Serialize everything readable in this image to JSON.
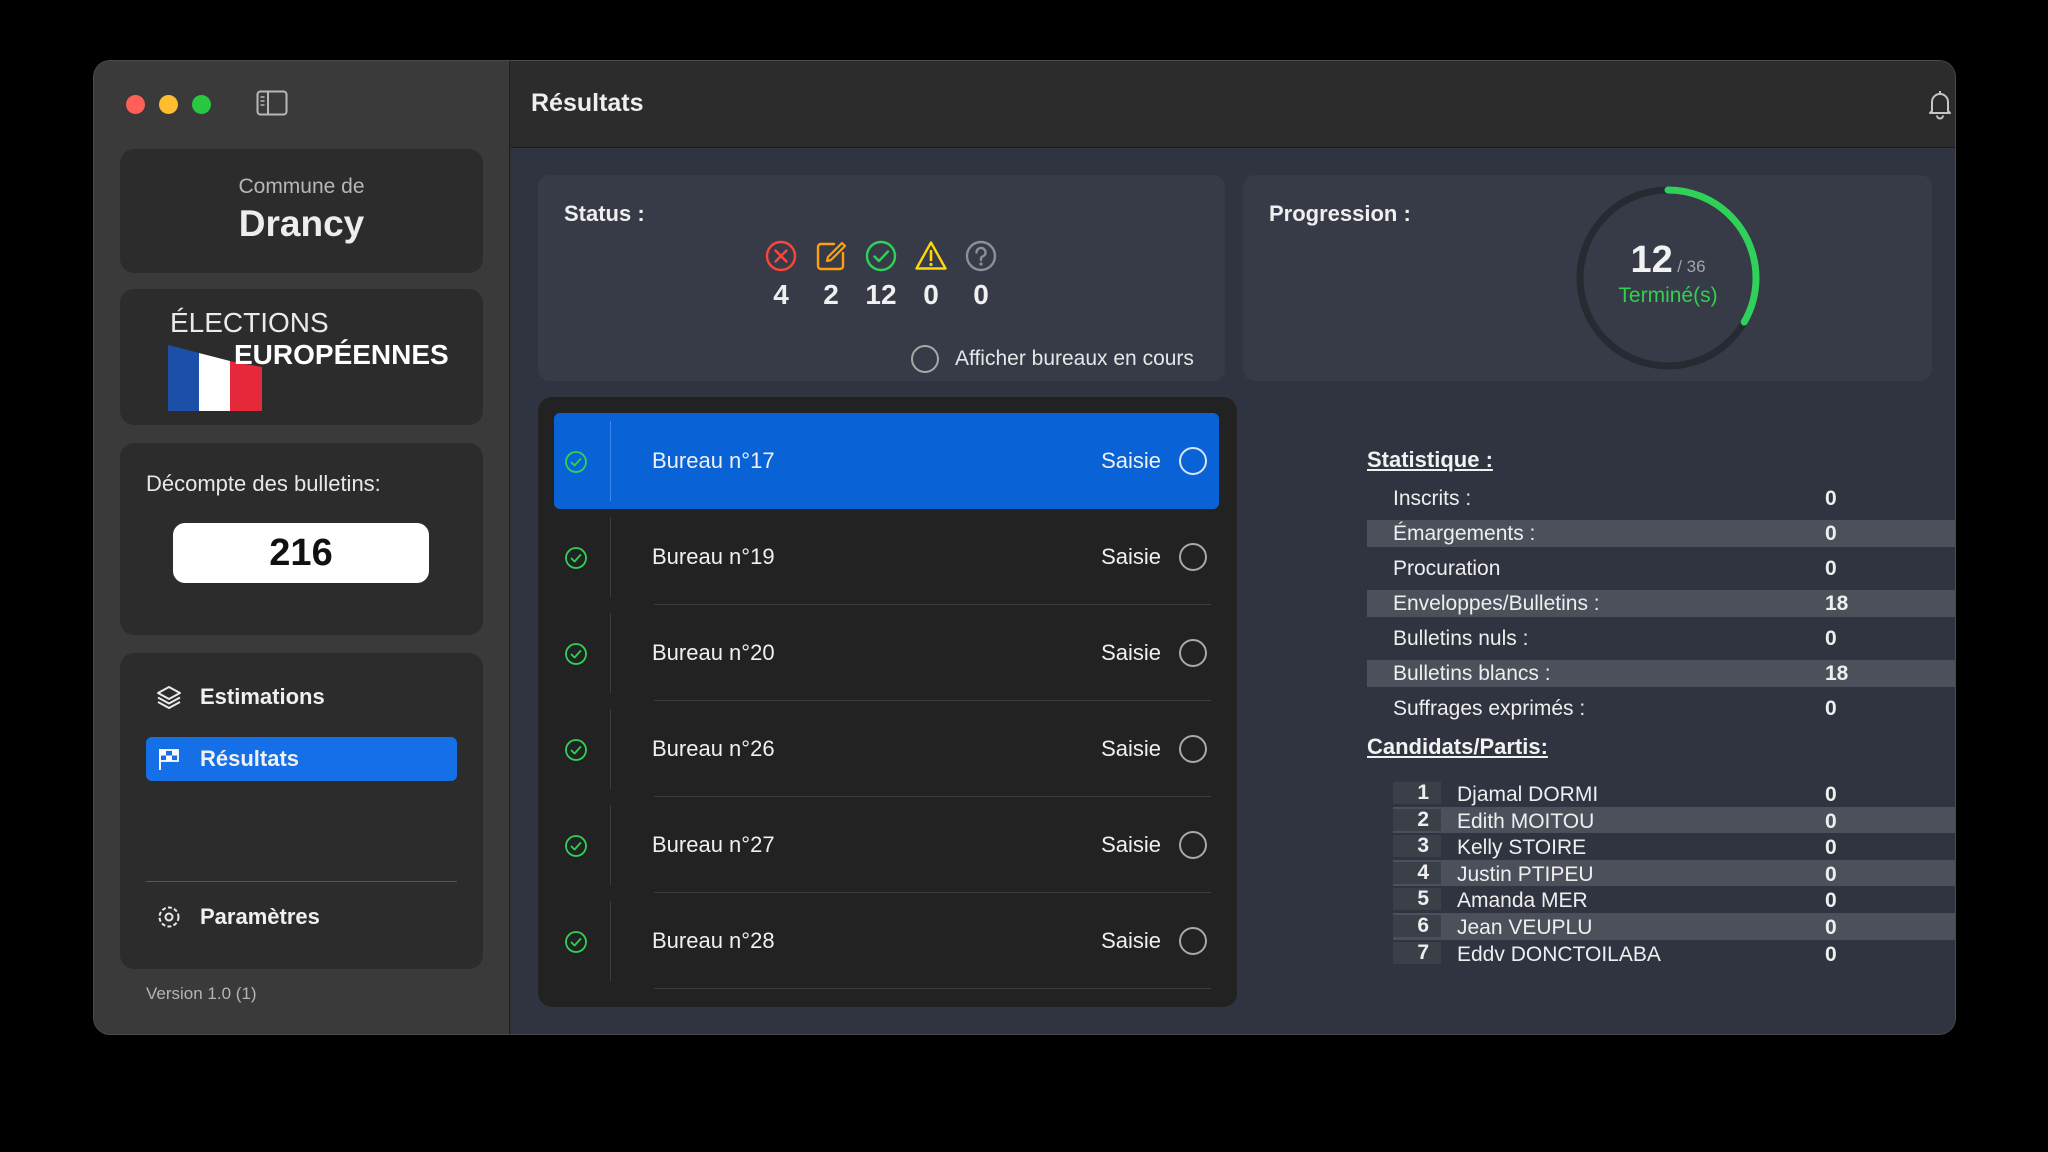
{
  "sidebar": {
    "commune_prefix": "Commune de",
    "commune_name": "Drancy",
    "elections_line1": "ÉLECTIONS",
    "elections_line2": "EUROPÉENNES",
    "decompte_label": "Décompte des bulletins:",
    "decompte_value": "216",
    "nav": {
      "estimations": "Estimations",
      "resultats": "Résultats",
      "parametres": "Paramètres"
    },
    "version": "Version 1.0 (1)"
  },
  "toolbar": {
    "title": "Résultats"
  },
  "status": {
    "label": "Status :",
    "counts": {
      "error": "4",
      "edit": "2",
      "done": "12",
      "warning": "0",
      "unknown": "0"
    },
    "colors": {
      "error": "#ff453a",
      "edit": "#ff9f0a",
      "done": "#30d158",
      "warning": "#ffd60a",
      "unknown": "#8e8e93"
    },
    "toggle_label": "Afficher bureaux en cours"
  },
  "progression": {
    "label": "Progression :",
    "value": "12",
    "total": "/ 36",
    "caption": "Terminé(s)",
    "fraction": 0.3333
  },
  "bureaux": [
    {
      "name": "Bureau n°17",
      "status": "Saisie",
      "selected": true
    },
    {
      "name": "Bureau n°19",
      "status": "Saisie"
    },
    {
      "name": "Bureau n°20",
      "status": "Saisie"
    },
    {
      "name": "Bureau n°26",
      "status": "Saisie"
    },
    {
      "name": "Bureau n°27",
      "status": "Saisie"
    },
    {
      "name": "Bureau n°28",
      "status": "Saisie"
    }
  ],
  "statistique": {
    "title": "Statistique :",
    "rows": [
      {
        "label": "Inscrits :",
        "value": "0"
      },
      {
        "label": "Émargements :",
        "value": "0"
      },
      {
        "label": "Procuration",
        "value": "0"
      },
      {
        "label": "Enveloppes/Bulletins :",
        "value": "18"
      },
      {
        "label": "Bulletins nuls :",
        "value": "0"
      },
      {
        "label": "Bulletins blancs :",
        "value": "18"
      },
      {
        "label": "Suffrages exprimés :",
        "value": "0"
      }
    ]
  },
  "candidats": {
    "title": "Candidats/Partis:",
    "rows": [
      {
        "num": "1",
        "name": "Djamal DORMI",
        "value": "0"
      },
      {
        "num": "2",
        "name": "Edith MOITOU",
        "value": "0"
      },
      {
        "num": "3",
        "name": "Kelly STOIRE",
        "value": "0"
      },
      {
        "num": "4",
        "name": "Justin PTIPEU",
        "value": "0"
      },
      {
        "num": "5",
        "name": "Amanda MER",
        "value": "0"
      },
      {
        "num": "6",
        "name": "Jean VEUPLU",
        "value": "0"
      },
      {
        "num": "7",
        "name": "Eddv DONCTOILABA",
        "value": "0"
      }
    ]
  }
}
